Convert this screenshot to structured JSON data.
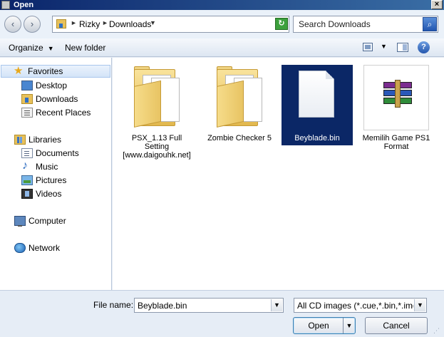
{
  "window": {
    "title": "Open",
    "close_glyph": "×"
  },
  "nav": {
    "back_glyph": "‹",
    "forward_glyph": "›",
    "breadcrumb": [
      "Rizky",
      "Downloads"
    ],
    "breadcrumb_sep": "►",
    "dropdown_glyph": "▼",
    "refresh_glyph": "↻",
    "search_placeholder": "Search Downloads",
    "search_glyph": "⌕"
  },
  "toolbar": {
    "organize_label": "Organize",
    "new_folder_label": "New folder",
    "caret": "▼",
    "help_glyph": "?"
  },
  "sidebar": {
    "favorites": {
      "label": "Favorites",
      "icon": "star-icon"
    },
    "favorite_items": [
      {
        "label": "Desktop",
        "icon": "desktop-icon"
      },
      {
        "label": "Downloads",
        "icon": "downloads-folder-icon"
      },
      {
        "label": "Recent Places",
        "icon": "recent-places-icon"
      }
    ],
    "libraries": {
      "label": "Libraries",
      "icon": "libraries-icon"
    },
    "library_items": [
      {
        "label": "Documents",
        "icon": "documents-icon"
      },
      {
        "label": "Music",
        "icon": "music-icon"
      },
      {
        "label": "Pictures",
        "icon": "pictures-icon"
      },
      {
        "label": "Videos",
        "icon": "videos-icon"
      }
    ],
    "computer": {
      "label": "Computer",
      "icon": "computer-icon"
    },
    "network": {
      "label": "Network",
      "icon": "network-icon"
    }
  },
  "files": [
    {
      "name": "PSX_1.13 Full Setting [www.daigouhk.net]",
      "type": "folder",
      "selected": false
    },
    {
      "name": "Zombie Checker 5",
      "type": "folder",
      "selected": false
    },
    {
      "name": "Beyblade.bin",
      "type": "file",
      "selected": true
    },
    {
      "name": "Memilih Game PS1 Format",
      "type": "winrar-archive",
      "selected": false
    }
  ],
  "footer": {
    "file_name_label": "File name:",
    "file_name_value": "Beyblade.bin",
    "file_type_value": "All CD images (*.cue,*.bin,*.img,*.iso)",
    "open_label": "Open",
    "cancel_label": "Cancel",
    "combo_glyph": "▼",
    "grip_glyph": "⋰"
  },
  "colors": {
    "selection": "#0b2766",
    "title_bar": "#0a246a",
    "nav_selected": "#d4e4f8"
  }
}
